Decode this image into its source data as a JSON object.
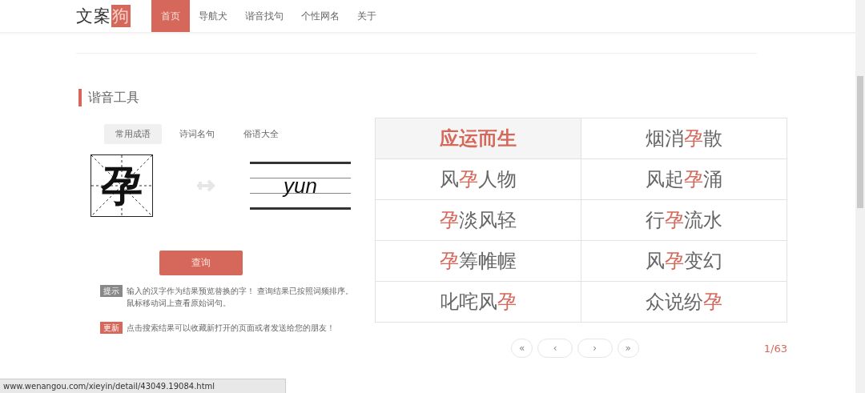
{
  "logo": {
    "text": "文案",
    "accent": "狗"
  },
  "nav": [
    {
      "label": "首页",
      "selected": true
    },
    {
      "label": "导航犬",
      "selected": false
    },
    {
      "label": "谐音找句",
      "selected": false
    },
    {
      "label": "个性网名",
      "selected": false
    },
    {
      "label": "关于",
      "selected": false
    }
  ],
  "section_title": "谐音工具",
  "tabs": [
    {
      "label": "常用成语",
      "selected": true
    },
    {
      "label": "诗词名句",
      "selected": false
    },
    {
      "label": "俗语大全",
      "selected": false
    }
  ],
  "character": "孕",
  "pinyin": "yun",
  "query_button": "查询",
  "notes": [
    {
      "kind": "tip",
      "badge": "提示",
      "text": "输入的汉字作为结果预览替换的字！ 查询结果已按照词频排序。鼠标移动词上查看原始词句。"
    },
    {
      "kind": "update",
      "badge": "更新",
      "text": "点击搜索结果可以收藏新打开的页面或者发送给您的朋友！"
    }
  ],
  "results": [
    {
      "selected": true,
      "text": "应运而生"
    },
    {
      "selected": false,
      "segments": [
        {
          "text": "烟消",
          "highlight": false
        },
        {
          "text": "孕",
          "highlight": true
        },
        {
          "text": "散",
          "highlight": false
        }
      ]
    },
    {
      "selected": false,
      "segments": [
        {
          "text": "风",
          "highlight": false
        },
        {
          "text": "孕",
          "highlight": true
        },
        {
          "text": "人物",
          "highlight": false
        }
      ]
    },
    {
      "selected": false,
      "segments": [
        {
          "text": "风起",
          "highlight": false
        },
        {
          "text": "孕",
          "highlight": true
        },
        {
          "text": "涌",
          "highlight": false
        }
      ]
    },
    {
      "selected": false,
      "segments": [
        {
          "text": "孕",
          "highlight": true
        },
        {
          "text": "淡风轻",
          "highlight": false
        }
      ]
    },
    {
      "selected": false,
      "segments": [
        {
          "text": "行",
          "highlight": false
        },
        {
          "text": "孕",
          "highlight": true
        },
        {
          "text": "流水",
          "highlight": false
        }
      ]
    },
    {
      "selected": false,
      "segments": [
        {
          "text": "孕",
          "highlight": true
        },
        {
          "text": "筹帷幄",
          "highlight": false
        }
      ]
    },
    {
      "selected": false,
      "segments": [
        {
          "text": "风",
          "highlight": false
        },
        {
          "text": "孕",
          "highlight": true
        },
        {
          "text": "变幻",
          "highlight": false
        }
      ]
    },
    {
      "selected": false,
      "segments": [
        {
          "text": "叱咤风",
          "highlight": false
        },
        {
          "text": "孕",
          "highlight": true
        }
      ]
    },
    {
      "selected": false,
      "segments": [
        {
          "text": "众说纷",
          "highlight": false
        },
        {
          "text": "孕",
          "highlight": true
        }
      ]
    }
  ],
  "pager": {
    "buttons": [
      {
        "kind": "first",
        "label": "«"
      },
      {
        "kind": "prev",
        "label": "‹"
      },
      {
        "kind": "next",
        "label": "›"
      },
      {
        "kind": "last",
        "label": "»"
      }
    ],
    "page": "1/63"
  },
  "status_bar": "www.wenangou.com/xieyin/detail/43049.19084.html"
}
